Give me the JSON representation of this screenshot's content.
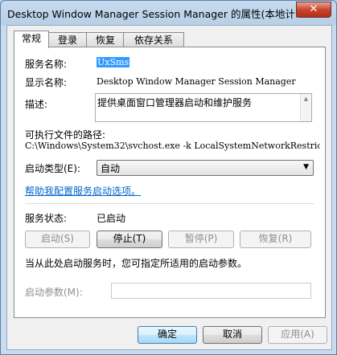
{
  "window": {
    "title": "Desktop Window Manager Session Manager 的属性(本地计...",
    "close_glyph": "✕"
  },
  "tabs": [
    {
      "label": "常规",
      "active": true
    },
    {
      "label": "登录",
      "active": false
    },
    {
      "label": "恢复",
      "active": false
    },
    {
      "label": "依存关系",
      "active": false
    }
  ],
  "general": {
    "service_name_label": "服务名称:",
    "service_name_value": "UxSms",
    "display_name_label": "显示名称:",
    "display_name_value": "Desktop Window Manager Session Manager",
    "description_label": "描述:",
    "description_value": "提供桌面窗口管理器启动和维护服务",
    "exe_path_label": "可执行文件的路径:",
    "exe_path_value": "C:\\Windows\\System32\\svchost.exe -k LocalSystemNetworkRestric",
    "startup_type_label": "启动类型(E):",
    "startup_type_value": "自动",
    "help_link": "帮助我配置服务启动选项。",
    "status_label": "服务状态:",
    "status_value": "已启动",
    "start_button": "启动(S)",
    "stop_button": "停止(T)",
    "pause_button": "暂停(P)",
    "resume_button": "恢复(R)",
    "hint_text": "当从此处启动服务时，您可指定所适用的启动参数。",
    "start_params_label": "启动参数(M):",
    "start_params_value": ""
  },
  "footer": {
    "ok_button": "确定",
    "cancel_button": "取消",
    "apply_button": "应用(A)"
  }
}
